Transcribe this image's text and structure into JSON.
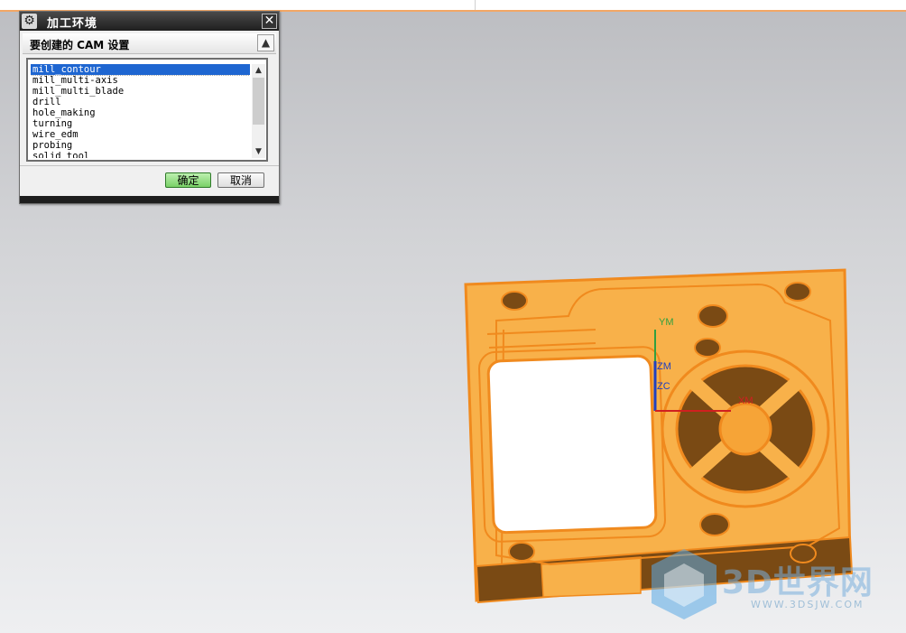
{
  "dialog": {
    "title": "加工环境",
    "section_title": "要创建的 CAM 设置",
    "setups": [
      "mill_contour",
      "mill_multi-axis",
      "mill_multi_blade",
      "drill",
      "hole_making",
      "turning",
      "wire_edm",
      "probing",
      "solid_tool"
    ],
    "selected_index": 0,
    "ok_label": "确定",
    "cancel_label": "取消"
  },
  "viewport": {
    "axis_labels": {
      "ym": "YM",
      "zm": "ZM",
      "zc": "ZC",
      "xm": "XM"
    },
    "model_color": "#f8b14a",
    "edge_color": "#f08a1e"
  },
  "watermark": {
    "brand": "3D世界网",
    "url": "WWW.3DSJW.COM"
  }
}
